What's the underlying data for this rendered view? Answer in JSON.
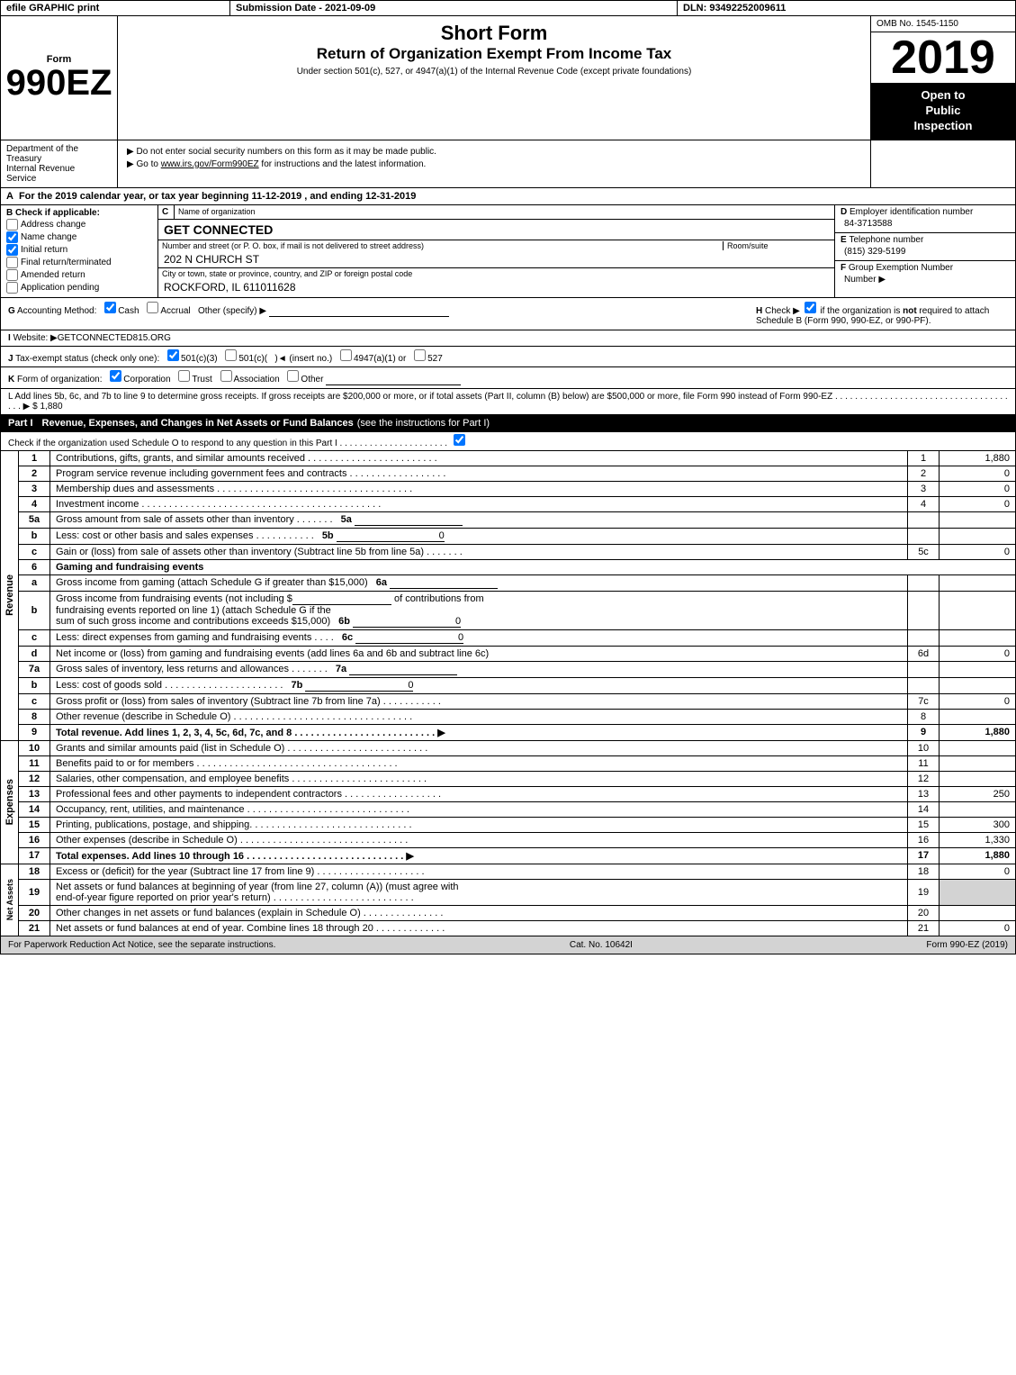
{
  "topbar": {
    "left": "efile GRAPHIC print",
    "mid": "Submission Date - 2021-09-09",
    "right": "DLN: 93492252009611"
  },
  "header": {
    "form_number": "990EZ",
    "form_sub": "Form",
    "title_main": "Short Form",
    "title_sub": "Return of Organization Exempt From Income Tax",
    "title_under": "Under section 501(c), 527, or 4947(a)(1) of the Internal Revenue Code (except private foundations)",
    "note1": "▶ Do not enter social security numbers on this form as it may be made public.",
    "note2": "▶ Go to www.irs.gov/Form990EZ for instructions and the latest information.",
    "omb": "OMB No. 1545-1150",
    "year": "2019",
    "open_public": "Open to\nPublic\nInspection"
  },
  "treasury": {
    "dept": "Department of the Treasury\nInternal Revenue\nService"
  },
  "section_a": {
    "label": "A",
    "text": "For the 2019 calendar year, or tax year beginning 11-12-2019 , and ending 12-31-2019"
  },
  "section_b": {
    "label": "B",
    "title": "Check if applicable:",
    "checkboxes": [
      {
        "id": "address_change",
        "label": "Address change",
        "checked": false
      },
      {
        "id": "name_change",
        "label": "Name change",
        "checked": true
      },
      {
        "id": "initial_return",
        "label": "Initial return",
        "checked": true
      },
      {
        "id": "final_return",
        "label": "Final return/terminated",
        "checked": false
      },
      {
        "id": "amended_return",
        "label": "Amended return",
        "checked": false
      },
      {
        "id": "app_pending",
        "label": "Application pending",
        "checked": false
      }
    ]
  },
  "section_c": {
    "label": "C",
    "title": "Name of organization",
    "org_name": "GET CONNECTED"
  },
  "section_d": {
    "label": "D",
    "title": "Employer identification number",
    "ein": "84-3713588"
  },
  "section_e": {
    "label": "E",
    "title": "Telephone number",
    "phone": "(815) 329-5199"
  },
  "section_f": {
    "label": "F",
    "title": "Group Exemption Number",
    "arrow": "▶"
  },
  "address": {
    "street_label": "Number and street (or P. O. box, if mail is not delivered to street address)",
    "room_label": "Room/suite",
    "street": "202 N CHURCH ST",
    "city_label": "City or town, state or province, country, and ZIP or foreign postal code",
    "city": "ROCKFORD, IL 611011628"
  },
  "section_g": {
    "label": "G",
    "text": "Accounting Method:",
    "cash_checked": true,
    "accrual_checked": false,
    "other_label": "Other (specify) ▶",
    "h_label": "H",
    "h_text": "Check ▶",
    "h_checked": true,
    "h_note": "if the organization is not required to attach Schedule B (Form 990, 990-EZ, or 990-PF)."
  },
  "section_i": {
    "label": "I",
    "text": "Website: ▶GETCONNECTED815.ORG"
  },
  "section_j": {
    "label": "J",
    "text": "Tax-exempt status (check only one):",
    "c3_checked": true,
    "options": "☑ 501(c)(3)  ○ 501(c)(  )◄ (insert no.)  ○ 4947(a)(1) or  ○ 527"
  },
  "section_k": {
    "label": "K",
    "text": "Form of organization:",
    "corp_checked": true,
    "options": "☑ Corporation  ○ Trust  ○ Association  ○ Other"
  },
  "section_l": {
    "text": "L Add lines 5b, 6c, and 7b to line 9 to determine gross receipts. If gross receipts are $200,000 or more, or if total assets (Part II, column (B) below) are $500,000 or more, file Form 990 instead of Form 990-EZ . . . . . . . . . . . . . . . . . . . . . . . . . . . . . . . . . . . . . . ▶ $ 1,880"
  },
  "part1": {
    "label": "Part I",
    "title": "Revenue, Expenses, and Changes in Net Assets or Fund Balances",
    "subtitle": "(see the instructions for Part I)",
    "check_note": "Check if the organization used Schedule O to respond to any question in this Part I . . . . . . . . . . . . . . . . . . . . . .",
    "check_checked": true,
    "rows": [
      {
        "num": "1",
        "desc": "Contributions, gifts, grants, and similar amounts received . . . . . . . . . . . . . . . . . . . . . . . .",
        "line": "1",
        "amount": "1,880"
      },
      {
        "num": "2",
        "desc": "Program service revenue including government fees and contracts . . . . . . . . . . . . . . . . . .",
        "line": "2",
        "amount": "0"
      },
      {
        "num": "3",
        "desc": "Membership dues and assessments . . . . . . . . . . . . . . . . . . . . . . . . . . . . . . . . . . . .",
        "line": "3",
        "amount": "0"
      },
      {
        "num": "4",
        "desc": "Investment income . . . . . . . . . . . . . . . . . . . . . . . . . . . . . . . . . . . . . . . . . . . .",
        "line": "4",
        "amount": "0"
      }
    ],
    "row5a": {
      "num": "5a",
      "desc": "Gross amount from sale of assets other than inventory . . . . . . .",
      "subline": "5a",
      "amount": ""
    },
    "row5b": {
      "num": "b",
      "desc": "Less: cost or other basis and sales expenses . . . . . . . . . . .",
      "subline": "5b",
      "amount": "0"
    },
    "row5c": {
      "num": "c",
      "desc": "Gain or (loss) from sale of assets other than inventory (Subtract line 5b from line 5a) . . . . . . .",
      "line": "5c",
      "amount": "0"
    },
    "row6": {
      "num": "6",
      "desc": "Gaming and fundraising events"
    },
    "row6a": {
      "num": "a",
      "desc": "Gross income from gaming (attach Schedule G if greater than $15,000)",
      "subline": "6a",
      "amount": ""
    },
    "row6b_desc": "Gross income from fundraising events (not including $",
    "row6b_blank": "_____________",
    "row6b_of": "of contributions from",
    "row6b2": "fundraising events reported on line 1) (attach Schedule G if the",
    "row6b3": "sum of such gross income and contributions exceeds $15,000)",
    "row6b": {
      "num": "b",
      "subline": "6b",
      "amount": "0"
    },
    "row6c": {
      "num": "c",
      "desc": "Less: direct expenses from gaming and fundraising events . . . .",
      "subline": "6c",
      "amount": "0"
    },
    "row6d": {
      "num": "d",
      "desc": "Net income or (loss) from gaming and fundraising events (add lines 6a and 6b and subtract line 6c)",
      "line": "6d",
      "amount": "0"
    },
    "row7a": {
      "num": "7a",
      "desc": "Gross sales of inventory, less returns and allowances . . . . . . .",
      "subline": "7a",
      "amount": ""
    },
    "row7b": {
      "num": "b",
      "desc": "Less: cost of goods sold . . . . . . . . . . . . . . . . . . . . . .",
      "subline": "7b",
      "amount": "0"
    },
    "row7c": {
      "num": "c",
      "desc": "Gross profit or (loss) from sales of inventory (Subtract line 7b from line 7a) . . . . . . . . . . .",
      "line": "7c",
      "amount": "0"
    },
    "row8": {
      "num": "8",
      "desc": "Other revenue (describe in Schedule O) . . . . . . . . . . . . . . . . . . . . . . . . . . . . . . . . .",
      "line": "8",
      "amount": ""
    },
    "row9": {
      "num": "9",
      "desc": "Total revenue. Add lines 1, 2, 3, 4, 5c, 6d, 7c, and 8 . . . . . . . . . . . . . . . . . . . . . . . . . ▶",
      "line": "9",
      "amount": "1,880",
      "bold": true
    }
  },
  "expenses": {
    "rows": [
      {
        "num": "10",
        "desc": "Grants and similar amounts paid (list in Schedule O) . . . . . . . . . . . . . . . . . . . . . . . . . .",
        "line": "10",
        "amount": ""
      },
      {
        "num": "11",
        "desc": "Benefits paid to or for members . . . . . . . . . . . . . . . . . . . . . . . . . . . . . . . . . . . . .",
        "line": "11",
        "amount": ""
      },
      {
        "num": "12",
        "desc": "Salaries, other compensation, and employee benefits . . . . . . . . . . . . . . . . . . . . . . . . .",
        "line": "12",
        "amount": ""
      },
      {
        "num": "13",
        "desc": "Professional fees and other payments to independent contractors . . . . . . . . . . . . . . . . . .",
        "line": "13",
        "amount": "250"
      },
      {
        "num": "14",
        "desc": "Occupancy, rent, utilities, and maintenance . . . . . . . . . . . . . . . . . . . . . . . . . . . . . .",
        "line": "14",
        "amount": ""
      },
      {
        "num": "15",
        "desc": "Printing, publications, postage, and shipping. . . . . . . . . . . . . . . . . . . . . . . . . . . . . .",
        "line": "15",
        "amount": "300"
      },
      {
        "num": "16",
        "desc": "Other expenses (describe in Schedule O) . . . . . . . . . . . . . . . . . . . . . . . . . . . . . . .",
        "line": "16",
        "amount": "1,330"
      },
      {
        "num": "17",
        "desc": "Total expenses. Add lines 10 through 16 . . . . . . . . . . . . . . . . . . . . . . . . . . . . . ▶",
        "line": "17",
        "amount": "1,880",
        "bold": true
      }
    ]
  },
  "net_assets": {
    "rows": [
      {
        "num": "18",
        "desc": "Excess or (deficit) for the year (Subtract line 17 from line 9) . . . . . . . . . . . . . . . . . . . .",
        "line": "18",
        "amount": "0"
      },
      {
        "num": "19",
        "desc": "Net assets or fund balances at beginning of year (from line 27, column (A)) (must agree with",
        "line": "19",
        "amount": "",
        "subrow": "end-of-year figure reported on prior year's return) . . . . . . . . . . . . . . . . . . . . . . . . . ."
      },
      {
        "num": "20",
        "desc": "Other changes in net assets or fund balances (explain in Schedule O) . . . . . . . . . . . . . . .",
        "line": "20",
        "amount": ""
      },
      {
        "num": "21",
        "desc": "Net assets or fund balances at end of year. Combine lines 18 through 20 . . . . . . . . . . . . .",
        "line": "21",
        "amount": "0"
      }
    ]
  },
  "footer": {
    "left": "For Paperwork Reduction Act Notice, see the separate instructions.",
    "mid": "Cat. No. 10642I",
    "right": "Form 990-EZ (2019)"
  }
}
